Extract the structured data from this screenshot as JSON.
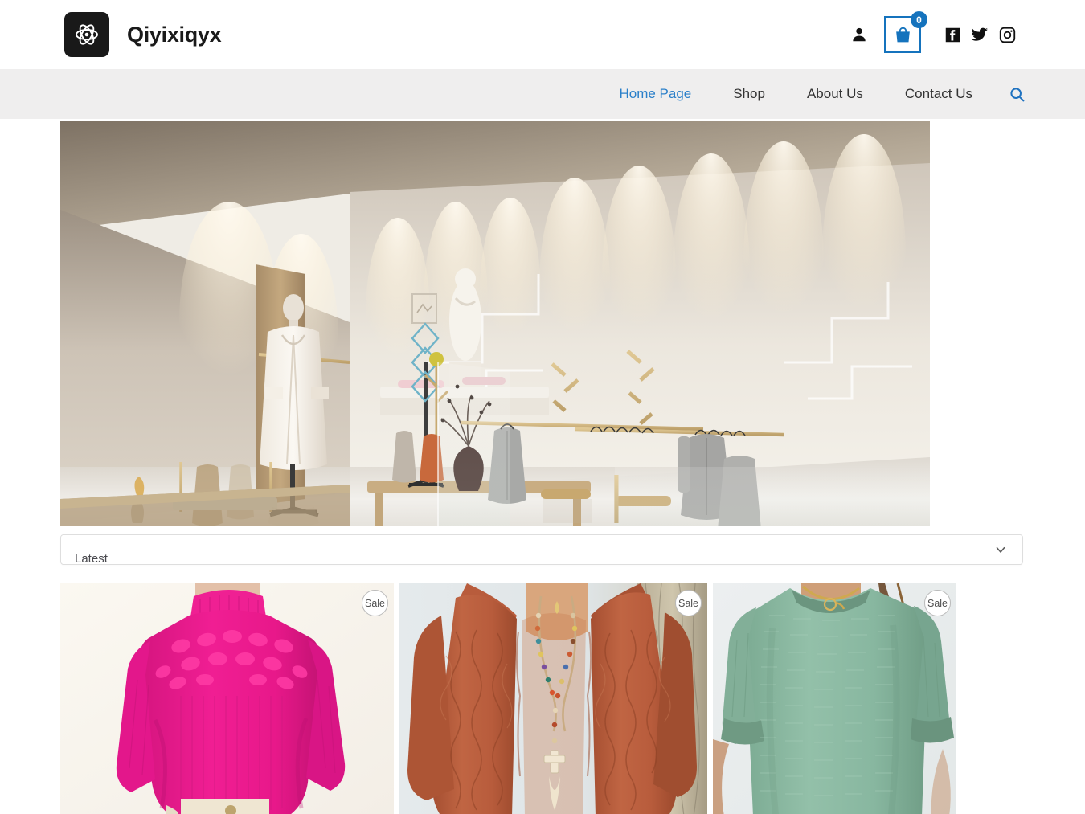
{
  "header": {
    "brand_name": "Qiyixiqyx",
    "logo_icon": "atom-flower-logo",
    "account_icon": "person-icon",
    "cart_icon": "shopping-bag-icon",
    "cart_count": "0",
    "social": [
      {
        "name": "facebook-icon",
        "label": "Facebook"
      },
      {
        "name": "twitter-icon",
        "label": "Twitter"
      },
      {
        "name": "instagram-icon",
        "label": "Instagram"
      }
    ]
  },
  "nav": {
    "items": [
      {
        "label": "Home Page",
        "active": true
      },
      {
        "label": "Shop",
        "active": false
      },
      {
        "label": "About Us",
        "active": false
      },
      {
        "label": "Contact Us",
        "active": false
      }
    ],
    "search_icon": "search-icon",
    "active_color": "#2a7fc9",
    "bar_color": "#efeeee"
  },
  "hero": {
    "alt": "Boutique clothing store interior with spotlights, gold garment racks and mannequin"
  },
  "sort": {
    "value": "Latest",
    "chevron_icon": "chevron-down-icon"
  },
  "products": [
    {
      "badge": "Sale",
      "alt": "Pink cable-knit turtleneck sweater",
      "color": "#ed1a8c"
    },
    {
      "badge": "Sale",
      "alt": "Rust hooded knit cardigan with beaded necklace",
      "color": "#bf6340"
    },
    {
      "badge": "Sale",
      "alt": "Sage green knit sweater with gold necklace",
      "color": "#8fbfa8"
    }
  ]
}
